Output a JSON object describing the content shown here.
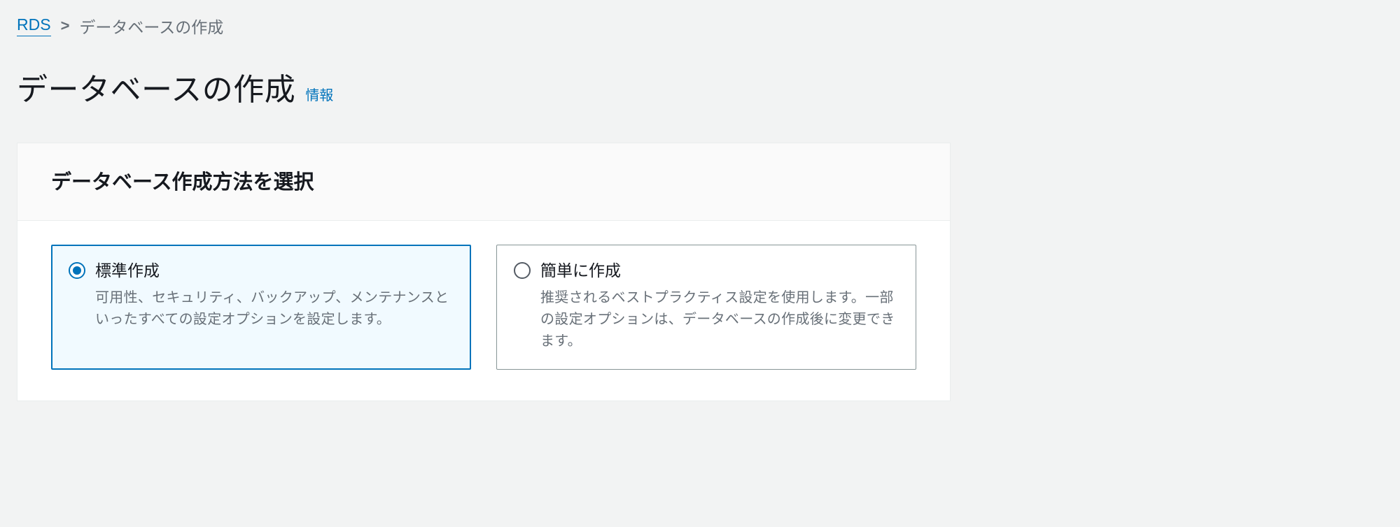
{
  "breadcrumb": {
    "root": "RDS",
    "current": "データベースの作成"
  },
  "header": {
    "title": "データベースの作成",
    "info_label": "情報"
  },
  "panel": {
    "heading": "データベース作成方法を選択"
  },
  "options": [
    {
      "title": "標準作成",
      "description": "可用性、セキュリティ、バックアップ、メンテナンスといったすべての設定オプションを設定します。",
      "selected": true
    },
    {
      "title": "簡単に作成",
      "description": "推奨されるベストプラクティス設定を使用します。一部の設定オプションは、データベースの作成後に変更できます。",
      "selected": false
    }
  ]
}
